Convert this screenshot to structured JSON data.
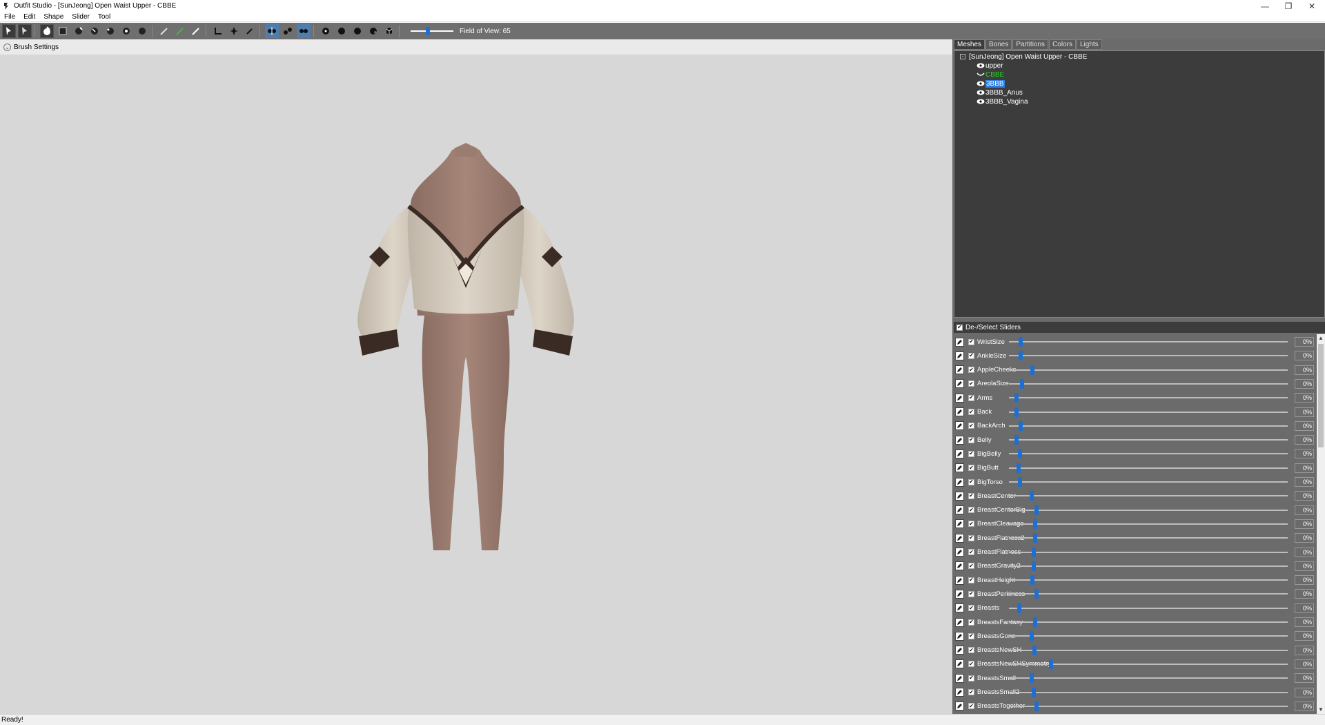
{
  "window": {
    "title": "Outfit Studio - [SunJeong] Open Waist Upper - CBBE",
    "controls": [
      "—",
      "❐",
      "✕"
    ]
  },
  "menu": [
    "File",
    "Edit",
    "Shape",
    "Slider",
    "Tool"
  ],
  "toolbar": {
    "field_of_view_label": "Field of View: 65",
    "field_of_view_level_percent": 40
  },
  "viewport": {
    "brush_settings_label": "Brush Settings"
  },
  "right_panel": {
    "tabs": [
      "Meshes",
      "Bones",
      "Partitions",
      "Colors",
      "Lights"
    ],
    "active_tab": "Meshes",
    "tree": {
      "root": "[SunJeong] Open Waist Upper - CBBE",
      "items": [
        {
          "label": "upper",
          "style": "normal"
        },
        {
          "label": "CBBE",
          "style": "green"
        },
        {
          "label": "3BBB",
          "style": "selected"
        },
        {
          "label": "3BBB_Anus",
          "style": "normal"
        },
        {
          "label": "3BBB_Vagina",
          "style": "normal"
        }
      ]
    },
    "sliders_header": "De-/Select Sliders",
    "sliders": [
      {
        "name": "WristSize",
        "value": "0%",
        "level": 0.014
      },
      {
        "name": "AnkleSize",
        "value": "0%",
        "level": 0.016
      },
      {
        "name": "AppleCheeks",
        "value": "0%",
        "level": 0.056
      },
      {
        "name": "AreolaSize",
        "value": "0%",
        "level": 0.02
      },
      {
        "name": "Arms",
        "value": "0%",
        "level": 0.0
      },
      {
        "name": "Back",
        "value": "0%",
        "level": 0.0
      },
      {
        "name": "BackArch",
        "value": "0%",
        "level": 0.016
      },
      {
        "name": "Belly",
        "value": "0%",
        "level": 0.0
      },
      {
        "name": "BigBelly",
        "value": "0%",
        "level": 0.012
      },
      {
        "name": "BigButt",
        "value": "0%",
        "level": 0.008
      },
      {
        "name": "BigTorso",
        "value": "0%",
        "level": 0.013
      },
      {
        "name": "BreastCenter",
        "value": "0%",
        "level": 0.055
      },
      {
        "name": "BreastCenterBig",
        "value": "0%",
        "level": 0.072
      },
      {
        "name": "BreastCleavage",
        "value": "0%",
        "level": 0.066
      },
      {
        "name": "BreastFlatness2",
        "value": "0%",
        "level": 0.067
      },
      {
        "name": "BreastFlatness",
        "value": "0%",
        "level": 0.062
      },
      {
        "name": "BreastGravity2",
        "value": "0%",
        "level": 0.063
      },
      {
        "name": "BreastHeight",
        "value": "0%",
        "level": 0.057
      },
      {
        "name": "BreastPerkiness",
        "value": "0%",
        "level": 0.071
      },
      {
        "name": "Breasts",
        "value": "0%",
        "level": 0.009
      },
      {
        "name": "BreastsFantasy",
        "value": "0%",
        "level": 0.066
      },
      {
        "name": "BreastsGone",
        "value": "0%",
        "level": 0.054
      },
      {
        "name": "BreastsNewSH",
        "value": "0%",
        "level": 0.064
      },
      {
        "name": "BreastsNewSHSymmetry",
        "value": "0%",
        "level": 0.123
      },
      {
        "name": "BreastsSmall",
        "value": "0%",
        "level": 0.055
      },
      {
        "name": "BreastsSmall2",
        "value": "0%",
        "level": 0.061
      },
      {
        "name": "BreastsTogether",
        "value": "0%",
        "level": 0.072
      }
    ]
  },
  "status": "Ready!",
  "colors": {
    "toolbar_bg": "#6f6f6f",
    "viewport_bg": "#d7d7d7",
    "panel_bg": "#3c3c3c",
    "slider_thumb": "#1f6fd0",
    "highlight": "#2b7de0",
    "green_label": "#2ad42a"
  },
  "icons": {
    "toolbar": [
      "brush-select-icon",
      "brush-mask-icon",
      "inflate-icon",
      "deflate-icon",
      "move-icon",
      "smooth-icon",
      "undiff-icon",
      "weight-icon",
      "color-icon",
      "alpha-icon",
      "brush-icon",
      "transform-icon",
      "pivot-icon",
      "vertex-select-icon",
      "mirror-x-icon",
      "connected-icon",
      "global-icon",
      "xray-icon",
      "wireframe-icon",
      "lighting-icon",
      "texture-icon",
      "shape-icon",
      "cube-icon"
    ]
  }
}
